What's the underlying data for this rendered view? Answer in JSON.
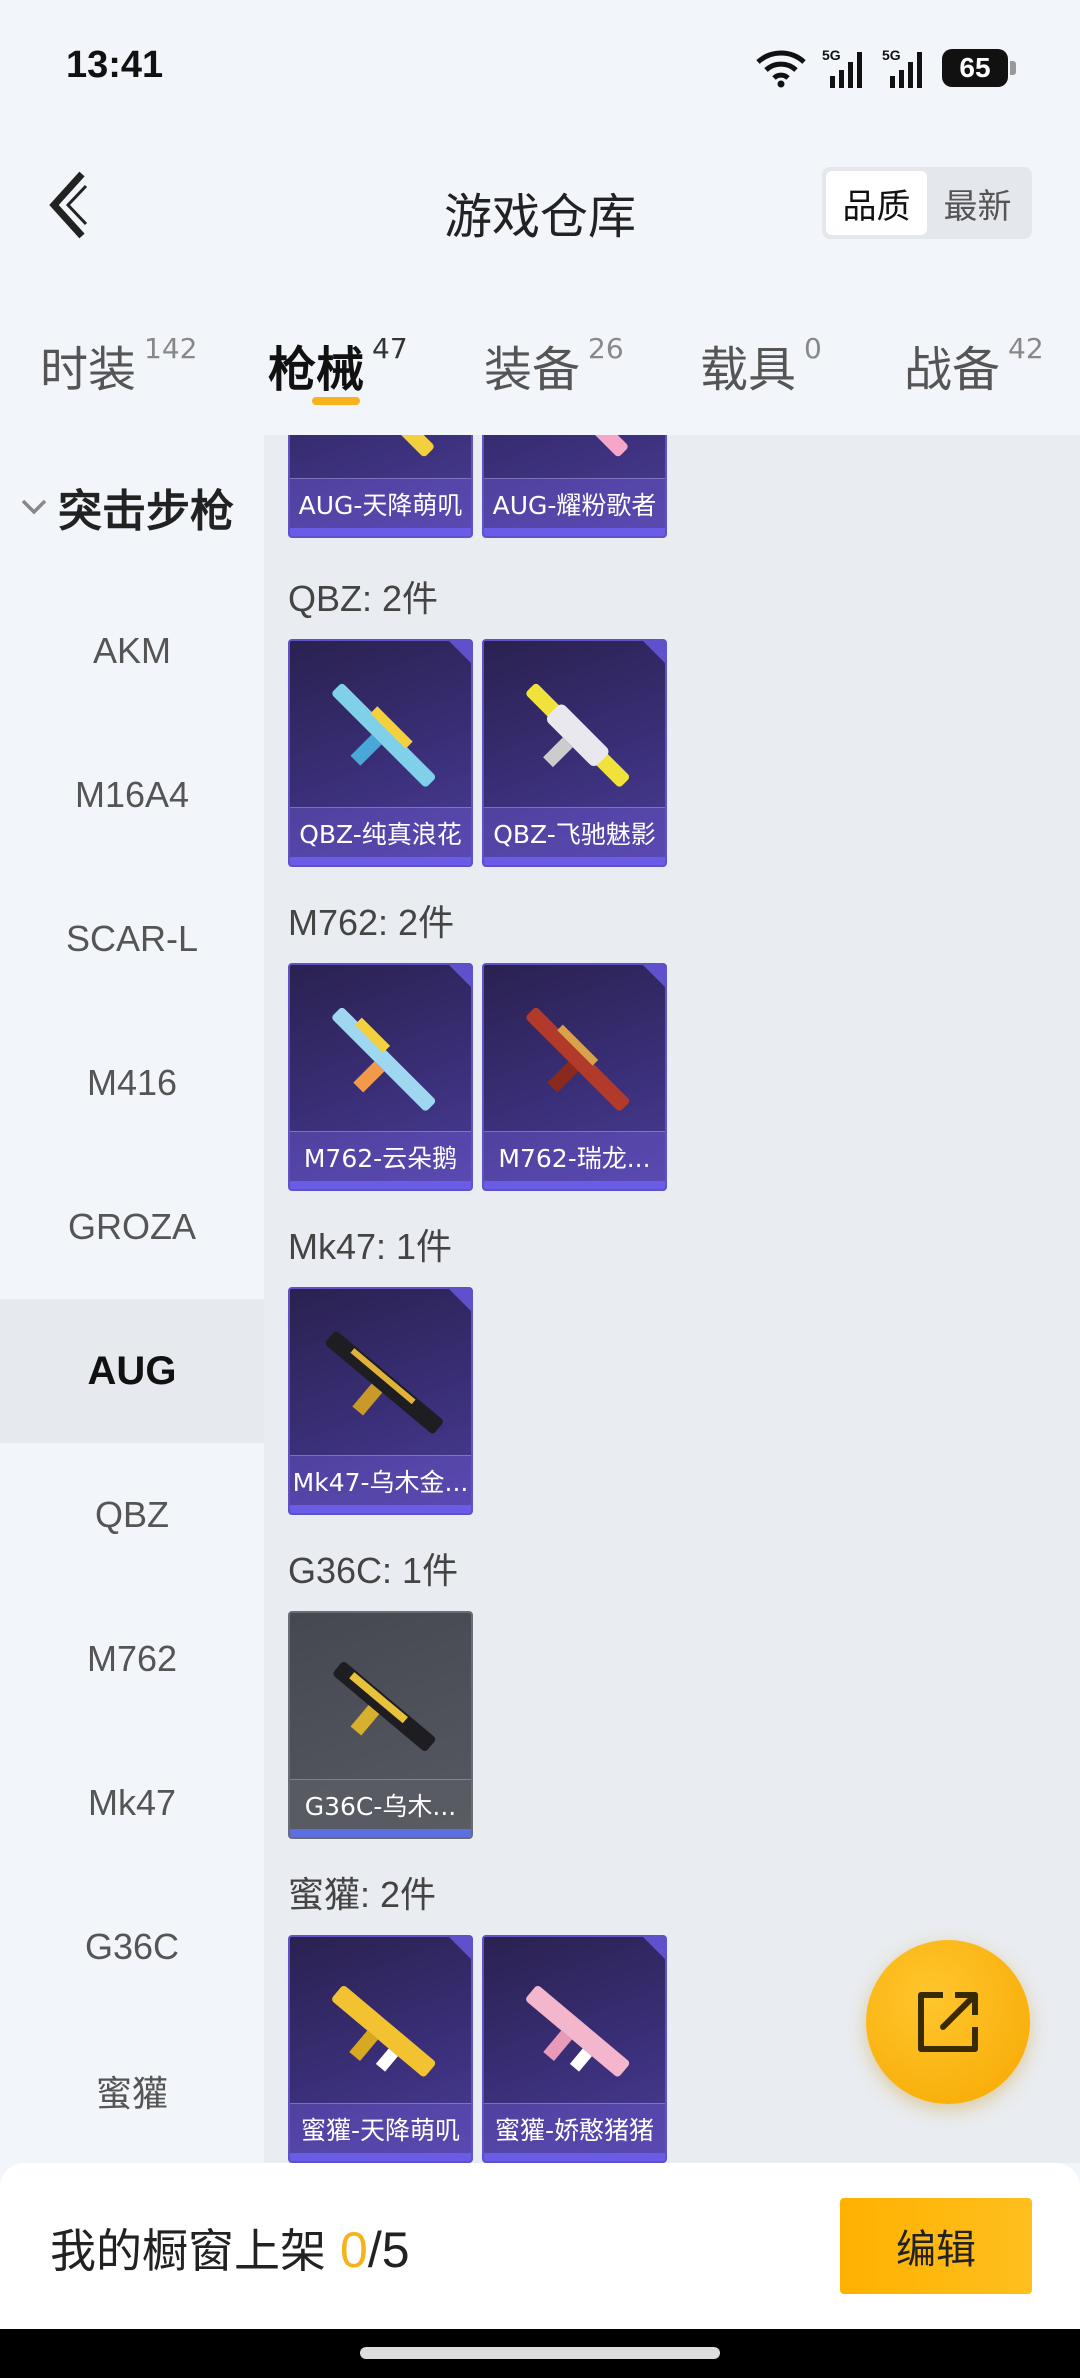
{
  "status_bar": {
    "time": "13:41",
    "battery": "65"
  },
  "header": {
    "title": "游戏仓库",
    "sort_options": [
      "品质",
      "最新"
    ]
  },
  "tabs": [
    {
      "label": "时装",
      "count": "142"
    },
    {
      "label": "枪械",
      "count": "47"
    },
    {
      "label": "装备",
      "count": "26"
    },
    {
      "label": "载具",
      "count": "0"
    },
    {
      "label": "战备",
      "count": "42"
    }
  ],
  "sidebar": {
    "group": "突击步枪",
    "items": [
      "AKM",
      "M16A4",
      "SCAR-L",
      "M416",
      "GROZA",
      "AUG",
      "QBZ",
      "M762",
      "Mk47",
      "G36C",
      "蜜獾"
    ]
  },
  "content": {
    "top_cards": [
      "AUG-天降萌叽",
      "AUG-耀粉歌者"
    ],
    "sections": [
      {
        "title": "QBZ: 2件",
        "cards": [
          "QBZ-纯真浪花",
          "QBZ-飞驰魅影"
        ]
      },
      {
        "title": "M762: 2件",
        "cards": [
          "M762-云朵鹅",
          "M762-瑞龙..."
        ]
      },
      {
        "title": "Mk47: 1件",
        "cards": [
          "Mk47-乌木金..."
        ]
      },
      {
        "title": "G36C: 1件",
        "cards": [
          "G36C-乌木..."
        ]
      },
      {
        "title": "蜜獾: 2件",
        "cards": [
          "蜜獾-天降萌叽",
          "蜜獾-娇憨猪猪"
        ]
      }
    ]
  },
  "bottom_bar": {
    "label": "我的橱窗上架",
    "current": "0",
    "separator": "/",
    "total": "5",
    "edit_label": "编辑"
  },
  "icons": [
    "back-icon",
    "wifi-icon",
    "signal-5g-icon",
    "battery-icon",
    "chevron-down-icon",
    "share-external-icon",
    "gun-icon"
  ],
  "colors": {
    "accent": "#f7b21e",
    "card_purple": "#3a2f78",
    "card_border": "#5f52c9"
  }
}
